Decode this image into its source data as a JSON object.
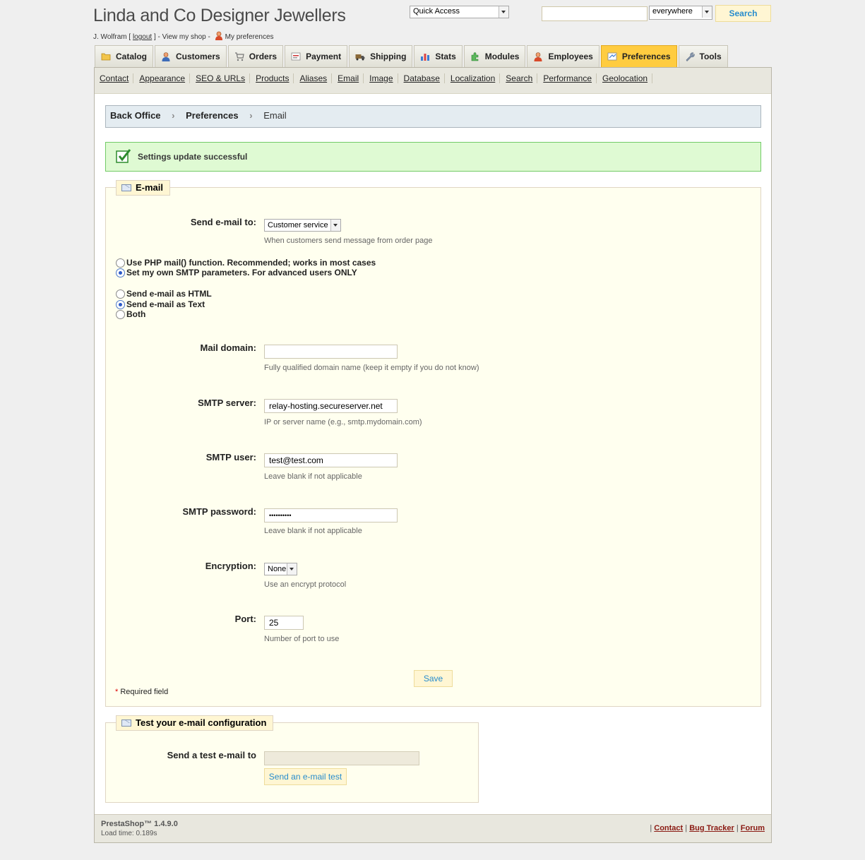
{
  "header": {
    "shop_name": "Linda and Co Designer Jewellers",
    "user_name": "J. Wolfram",
    "logout": "logout",
    "view_shop": "View my shop",
    "my_preferences": "My preferences",
    "quick_access": "Quick Access",
    "search_value": "",
    "search_scope": "everywhere",
    "search_button": "Search"
  },
  "tabs": [
    {
      "label": "Catalog",
      "icon": "folder-icon"
    },
    {
      "label": "Customers",
      "icon": "customer-icon"
    },
    {
      "label": "Orders",
      "icon": "cart-icon"
    },
    {
      "label": "Payment",
      "icon": "payment-icon"
    },
    {
      "label": "Shipping",
      "icon": "truck-icon"
    },
    {
      "label": "Stats",
      "icon": "bar-chart-icon"
    },
    {
      "label": "Modules",
      "icon": "puzzle-icon"
    },
    {
      "label": "Employees",
      "icon": "employee-icon"
    },
    {
      "label": "Preferences",
      "icon": "preferences-icon",
      "active": true
    },
    {
      "label": "Tools",
      "icon": "wrench-icon"
    }
  ],
  "subtabs": [
    "Contact",
    "Appearance",
    "SEO & URLs",
    "Products",
    "Aliases",
    "Email",
    "Image",
    "Database",
    "Localization",
    "Search",
    "Performance",
    "Geolocation"
  ],
  "breadcrumb": {
    "root": "Back Office",
    "parent": "Preferences",
    "current": "Email"
  },
  "success_message": "Settings update successful",
  "email_form": {
    "legend": "E-mail",
    "send_to_label": "Send e-mail to:",
    "send_to_value": "Customer service",
    "send_to_hint": "When customers send message from order page",
    "method_php": "Use PHP mail() function. Recommended; works in most cases",
    "method_smtp": "Set my own SMTP parameters. For advanced users ONLY",
    "format_html": "Send e-mail as HTML",
    "format_text": "Send e-mail as Text",
    "format_both": "Both",
    "mail_domain_label": "Mail domain:",
    "mail_domain_value": "",
    "mail_domain_hint": "Fully qualified domain name (keep it empty if you do not know)",
    "smtp_server_label": "SMTP server:",
    "smtp_server_value": "relay-hosting.secureserver.net",
    "smtp_server_hint": "IP or server name (e.g., smtp.mydomain.com)",
    "smtp_user_label": "SMTP user:",
    "smtp_user_value": "test@test.com",
    "smtp_user_hint": "Leave blank if not applicable",
    "smtp_password_label": "SMTP password:",
    "smtp_password_value": "••••••••••",
    "smtp_password_hint": "Leave blank if not applicable",
    "encryption_label": "Encryption:",
    "encryption_value": "None",
    "encryption_hint": "Use an encrypt protocol",
    "port_label": "Port:",
    "port_value": "25",
    "port_hint": "Number of port to use",
    "save_button": "Save",
    "required_star": "*",
    "required_text": "Required field"
  },
  "test_form": {
    "legend": "Test your e-mail configuration",
    "label": "Send a test e-mail to",
    "value": "",
    "button": "Send an e-mail test"
  },
  "footer": {
    "version": "PrestaShop™ 1.4.9.0",
    "load_time": "Load time: 0.189s",
    "contact": "Contact",
    "bug_tracker": "Bug Tracker",
    "forum": "Forum"
  }
}
